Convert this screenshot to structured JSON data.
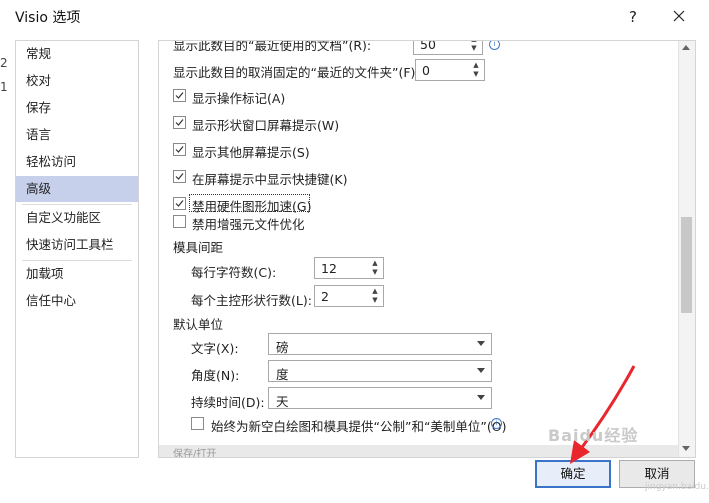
{
  "window": {
    "title": "Visio 选项",
    "help_glyph": "?",
    "edge_fragments": [
      "2",
      "1"
    ]
  },
  "sidebar": {
    "items": [
      {
        "label": "常规"
      },
      {
        "label": "校对"
      },
      {
        "label": "保存"
      },
      {
        "label": "语言"
      },
      {
        "label": "轻松访问"
      },
      {
        "label": "高级",
        "active": true
      },
      {
        "label": "自定义功能区"
      },
      {
        "label": "快速访问工具栏"
      },
      {
        "label": "加载项"
      },
      {
        "label": "信任中心"
      }
    ]
  },
  "content": {
    "partial_top_label": "显示此数目的“最近使用的文档”(R):",
    "partial_top_value": "50",
    "pinned_folders_label": "显示此数目的取消固定的“最近的文件夹”(F):",
    "pinned_folders_value": "0",
    "checkboxes": [
      {
        "label": "显示操作标记(A)",
        "checked": true
      },
      {
        "label": "显示形状窗口屏幕提示(W)",
        "checked": true
      },
      {
        "label": "显示其他屏幕提示(S)",
        "checked": true
      },
      {
        "label": "在屏幕提示中显示快捷键(K)",
        "checked": true
      },
      {
        "label": "禁用硬件图形加速(G)",
        "checked": true,
        "focused": true
      },
      {
        "label": "禁用增强元文件优化",
        "checked": false
      }
    ],
    "stencil_spacing": {
      "heading": "模具间距",
      "chars_per_row_label": "每行字符数(C):",
      "chars_per_row_value": "12",
      "rows_per_master_label": "每个主控形状行数(L):",
      "rows_per_master_value": "2"
    },
    "default_units": {
      "heading": "默认单位",
      "text_label": "文字(X):",
      "text_value": "磅",
      "angle_label": "角度(N):",
      "angle_value": "度",
      "duration_label": "持续时间(D):",
      "duration_value": "天",
      "metric_us_label": "始终为新空白绘图和模具提供“公制”和“美制单位”(O)",
      "metric_us_checked": false
    },
    "next_section_partial": "保存/打开"
  },
  "footer": {
    "ok_label": "确定",
    "cancel_label": "取消"
  },
  "overlay": {
    "watermark": "Baidu经验",
    "watermark_sub": "jingyan.baidu.com",
    "arrow_color": "#e8262b"
  },
  "colors": {
    "active_nav": "#c7d0ea",
    "primary_border": "#3a74c8"
  }
}
